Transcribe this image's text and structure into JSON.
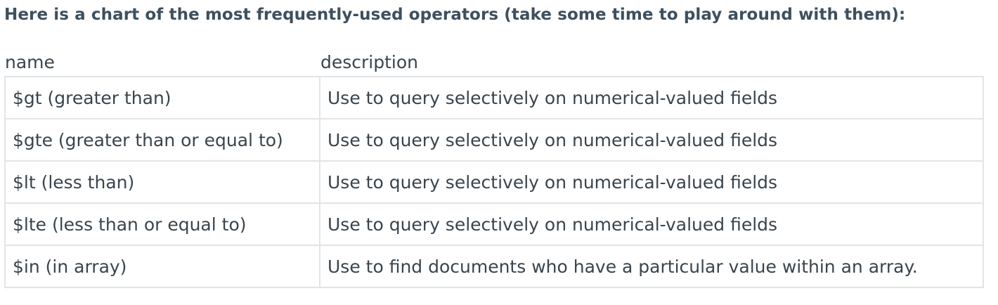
{
  "heading": "Here is a chart of the most frequently-used operators (take some time to play around with them):",
  "table": {
    "headers": [
      "name",
      "description"
    ],
    "rows": [
      {
        "name": "$gt (greater than)",
        "description": "Use to query selectively on numerical-valued fields"
      },
      {
        "name": "$gte (greater than or equal to)",
        "description": "Use to query selectively on numerical-valued fields"
      },
      {
        "name": "$lt (less than)",
        "description": "Use to query selectively on numerical-valued fields"
      },
      {
        "name": "$lte (less than or equal to)",
        "description": "Use to query selectively on numerical-valued fields"
      },
      {
        "name": "$in (in array)",
        "description": "Use to find documents who have a particular value within an array."
      }
    ]
  }
}
